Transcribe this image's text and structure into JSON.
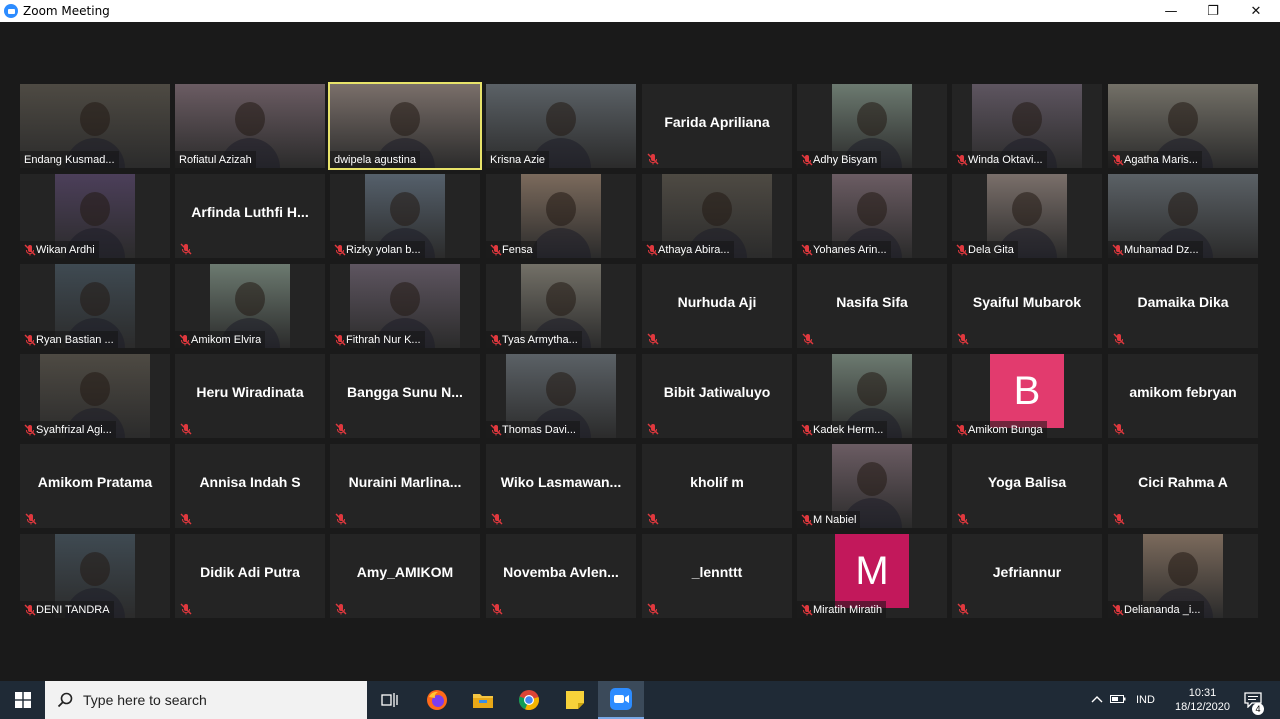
{
  "window": {
    "title": "Zoom Meeting",
    "minimize": "—",
    "maximize": "❐",
    "close": "✕"
  },
  "colors": {
    "mic_muted": "#e0383e",
    "active_speaker": "#e8e36a",
    "avatar_b": "#e23b6e",
    "avatar_m": "#c2185b"
  },
  "participants": [
    {
      "name": "Endang Kusmad...",
      "video": true
    },
    {
      "name": "Rofiatul Azizah",
      "video": true
    },
    {
      "name": "dwipela agustina",
      "video": true,
      "active": true
    },
    {
      "name": "Krisna Azie",
      "video": true
    },
    {
      "name": "Farida Apriliana",
      "video": false
    },
    {
      "name": "Adhy Bisyam",
      "video": true
    },
    {
      "name": "Winda Oktavi...",
      "video": true
    },
    {
      "name": "Agatha Maris...",
      "video": true
    },
    {
      "name": "Wikan Ardhi",
      "video": true
    },
    {
      "name": "Arfinda Luthfi H...",
      "video": false
    },
    {
      "name": "Rizky yolan b...",
      "video": true
    },
    {
      "name": "Fensa",
      "video": true
    },
    {
      "name": "Athaya Abira...",
      "video": true
    },
    {
      "name": "Yohanes Arin...",
      "video": true
    },
    {
      "name": "Dela Gita",
      "video": true
    },
    {
      "name": "Muhamad Dz...",
      "video": true
    },
    {
      "name": "Ryan Bastian ...",
      "video": true
    },
    {
      "name": "Amikom Elvira",
      "video": true
    },
    {
      "name": "Fithrah Nur K...",
      "video": true
    },
    {
      "name": "Tyas Armytha...",
      "video": true
    },
    {
      "name": "Nurhuda Aji",
      "video": false
    },
    {
      "name": "Nasifa Sifa",
      "video": false
    },
    {
      "name": "Syaiful Mubarok",
      "video": false
    },
    {
      "name": "Damaika Dika",
      "video": false
    },
    {
      "name": "Syahfrizal Agi...",
      "video": true
    },
    {
      "name": "Heru Wiradinata",
      "video": false
    },
    {
      "name": "Bangga Sunu N...",
      "video": false
    },
    {
      "name": "Thomas Davi...",
      "video": true
    },
    {
      "name": "Bibit Jatiwaluyo",
      "video": false
    },
    {
      "name": "Kadek Herm...",
      "video": true
    },
    {
      "name": "Amikom Bunga",
      "video": true,
      "avatar_letter": "B"
    },
    {
      "name": "amikom febryan",
      "video": false
    },
    {
      "name": "Amikom Pratama",
      "video": false
    },
    {
      "name": "Annisa Indah S",
      "video": false
    },
    {
      "name": "Nuraini Marlina...",
      "video": false
    },
    {
      "name": "Wiko Lasmawan...",
      "video": false
    },
    {
      "name": "kholif m",
      "video": false
    },
    {
      "name": "M Nabiel",
      "video": true
    },
    {
      "name": "Yoga Balisa",
      "video": false
    },
    {
      "name": "Cici Rahma A",
      "video": false
    },
    {
      "name": "DENI TANDRA",
      "video": true
    },
    {
      "name": "Didik Adi Putra",
      "video": false
    },
    {
      "name": "Amy_AMIKOM",
      "video": false
    },
    {
      "name": "Novemba Avlen...",
      "video": false
    },
    {
      "name": "_lennttt",
      "video": false
    },
    {
      "name": "Miratih Miratih",
      "video": true,
      "avatar_letter": "M"
    },
    {
      "name": "Jefriannur",
      "video": false
    },
    {
      "name": "Deliananda _i...",
      "video": true
    }
  ],
  "taskbar": {
    "search_placeholder": "Type here to search",
    "language": "IND",
    "time": "10:31",
    "date": "18/12/2020",
    "notifications": "4",
    "apps": [
      "task-view-icon",
      "firefox-icon",
      "file-explorer-icon",
      "chrome-icon",
      "sticky-notes-icon",
      "zoom-icon"
    ]
  }
}
